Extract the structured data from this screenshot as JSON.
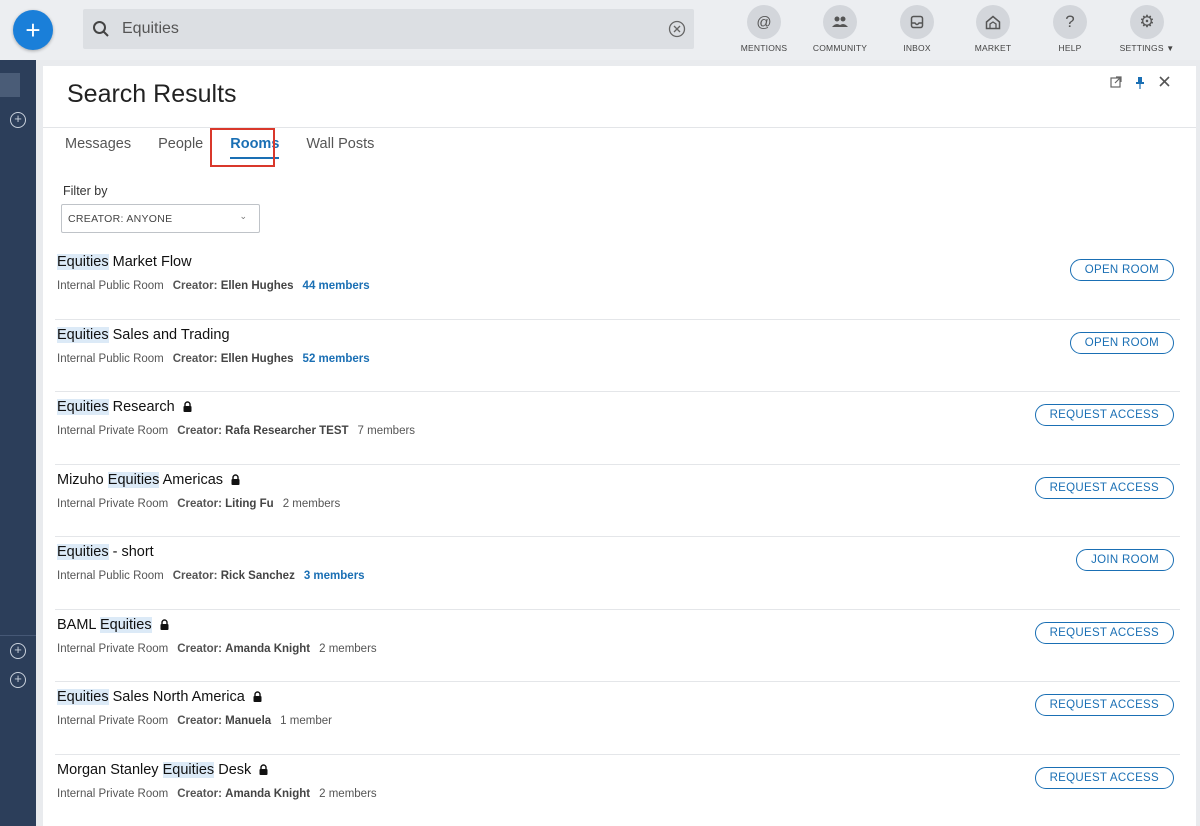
{
  "topbar": {
    "search_value": "Equities",
    "nav": [
      {
        "id": "mentions",
        "label": "MENTIONS",
        "icon": "at-icon"
      },
      {
        "id": "community",
        "label": "COMMUNITY",
        "icon": "people-icon"
      },
      {
        "id": "inbox",
        "label": "INBOX",
        "icon": "inbox-icon"
      },
      {
        "id": "market",
        "label": "MARKET",
        "icon": "market-icon"
      },
      {
        "id": "help",
        "label": "HELP",
        "icon": "question-icon"
      },
      {
        "id": "settings",
        "label": "SETTINGS",
        "icon": "gear-icon"
      }
    ]
  },
  "panel": {
    "title": "Search Results",
    "tabs": [
      {
        "label": "Messages"
      },
      {
        "label": "People"
      },
      {
        "label": "Rooms"
      },
      {
        "label": "Wall Posts"
      }
    ],
    "active_tab": "Rooms",
    "filter_label": "Filter by",
    "filter_value": "CREATOR: ANYONE"
  },
  "results": [
    {
      "name_parts": [
        [
          "Equities",
          true
        ],
        [
          " Market Flow",
          false
        ]
      ],
      "locked": false,
      "room_type": "Internal Public Room",
      "creator_label": "Creator:",
      "creator": "Ellen Hughes",
      "members": "44 members",
      "members_link": true,
      "action": "OPEN ROOM"
    },
    {
      "name_parts": [
        [
          "Equities",
          true
        ],
        [
          " Sales and Trading",
          false
        ]
      ],
      "locked": false,
      "room_type": "Internal Public Room",
      "creator_label": "Creator:",
      "creator": "Ellen Hughes",
      "members": "52 members",
      "members_link": true,
      "action": "OPEN ROOM"
    },
    {
      "name_parts": [
        [
          "Equities",
          true
        ],
        [
          " Research",
          false
        ]
      ],
      "locked": true,
      "room_type": "Internal Private Room",
      "creator_label": "Creator:",
      "creator": "Rafa Researcher TEST",
      "members": "7 members",
      "members_link": false,
      "action": "REQUEST ACCESS"
    },
    {
      "name_parts": [
        [
          "Mizuho ",
          false
        ],
        [
          "Equities",
          true
        ],
        [
          " Americas",
          false
        ]
      ],
      "locked": true,
      "room_type": "Internal Private Room",
      "creator_label": "Creator:",
      "creator": "Liting Fu",
      "members": "2 members",
      "members_link": false,
      "action": "REQUEST ACCESS"
    },
    {
      "name_parts": [
        [
          "Equities",
          true
        ],
        [
          " - short",
          false
        ]
      ],
      "locked": false,
      "room_type": "Internal Public Room",
      "creator_label": "Creator:",
      "creator": "Rick Sanchez",
      "members": "3 members",
      "members_link": true,
      "action": "JOIN ROOM"
    },
    {
      "name_parts": [
        [
          "BAML ",
          false
        ],
        [
          "Equities",
          true
        ]
      ],
      "locked": true,
      "room_type": "Internal Private Room",
      "creator_label": "Creator:",
      "creator": "Amanda Knight",
      "members": "2 members",
      "members_link": false,
      "action": "REQUEST ACCESS"
    },
    {
      "name_parts": [
        [
          "Equities",
          true
        ],
        [
          " Sales North America",
          false
        ]
      ],
      "locked": true,
      "room_type": "Internal Private Room",
      "creator_label": "Creator:",
      "creator": "Manuela",
      "members": "1 member",
      "members_link": false,
      "action": "REQUEST ACCESS"
    },
    {
      "name_parts": [
        [
          "Morgan Stanley ",
          false
        ],
        [
          "Equities",
          true
        ],
        [
          " Desk",
          false
        ]
      ],
      "locked": true,
      "room_type": "Internal Private Room",
      "creator_label": "Creator:",
      "creator": "Amanda Knight",
      "members": "2 members",
      "members_link": false,
      "action": "REQUEST ACCESS"
    }
  ]
}
